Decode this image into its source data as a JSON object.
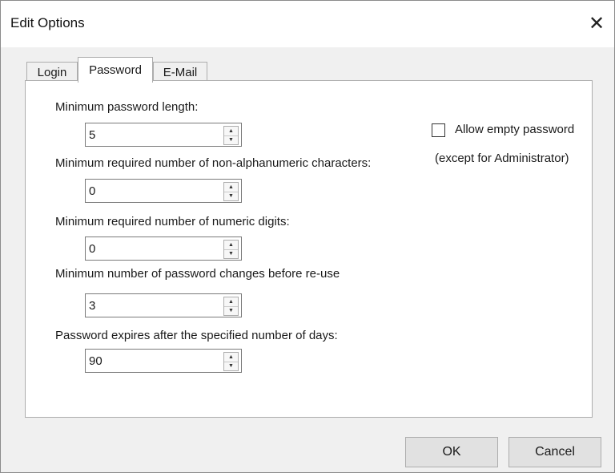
{
  "dialog": {
    "title": "Edit Options",
    "close_glyph": "✕"
  },
  "tabs": [
    {
      "label": "Login",
      "active": false
    },
    {
      "label": "Password",
      "active": true
    },
    {
      "label": "E-Mail",
      "active": false
    }
  ],
  "password": {
    "min_length": {
      "label": "Minimum password length:",
      "value": "5"
    },
    "non_alnum": {
      "label": "Minimum required number of non-alphanumeric characters:",
      "value": "0"
    },
    "numeric": {
      "label": "Minimum required number of numeric digits:",
      "value": "0"
    },
    "reuse": {
      "label": "Minimum number of password changes before re-use",
      "value": "3"
    },
    "expires": {
      "label": "Password expires after the specified number of days:",
      "value": "90"
    },
    "allow_empty": {
      "label": "Allow empty password",
      "note": "(except for Administrator)",
      "checked": false
    }
  },
  "spin_icons": {
    "up": "▲",
    "down": "▼"
  },
  "footer": {
    "ok_label": "OK",
    "cancel_label": "Cancel"
  }
}
